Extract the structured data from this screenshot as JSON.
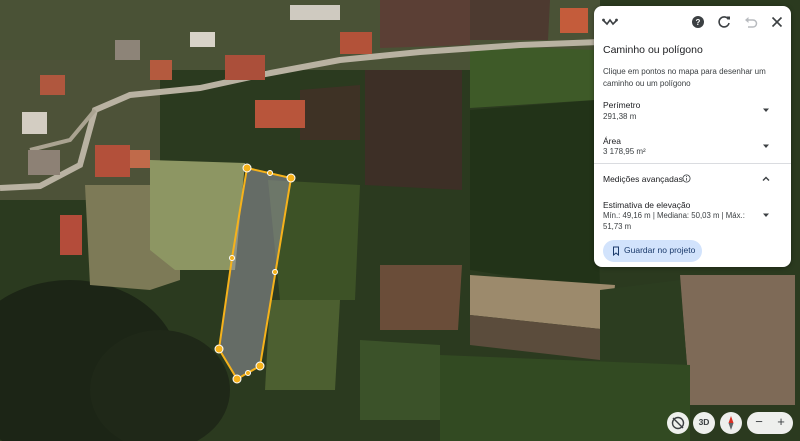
{
  "panel": {
    "title": "Caminho ou polígono",
    "description": "Clique em pontos no mapa para desenhar um caminho ou um polígono",
    "perimeter_label": "Perímetro",
    "perimeter_value": "291,38 m",
    "area_label": "Área",
    "area_value": "3 178,95 m²",
    "advanced_label": "Medições avançadas",
    "elevation_label": "Estimativa de elevação",
    "elevation_value": "Mín.: 49,16 m | Mediana: 50,03 m | Máx.: 51,73 m",
    "save_label": "Guardar no projeto",
    "icons": {
      "path": "path-icon",
      "help": "help-icon",
      "refresh": "refresh-icon",
      "undo": "undo-icon",
      "close": "close-icon",
      "info": "info-icon",
      "bookmark": "bookmark-icon"
    }
  },
  "map_controls": {
    "mode_3d_label": "3D",
    "zoom_out_label": "−",
    "zoom_in_label": "+"
  },
  "colors": {
    "polygon_stroke": "#f6b21b",
    "accent": "#1a73e8",
    "save_button_bg": "#d2e3fc"
  }
}
